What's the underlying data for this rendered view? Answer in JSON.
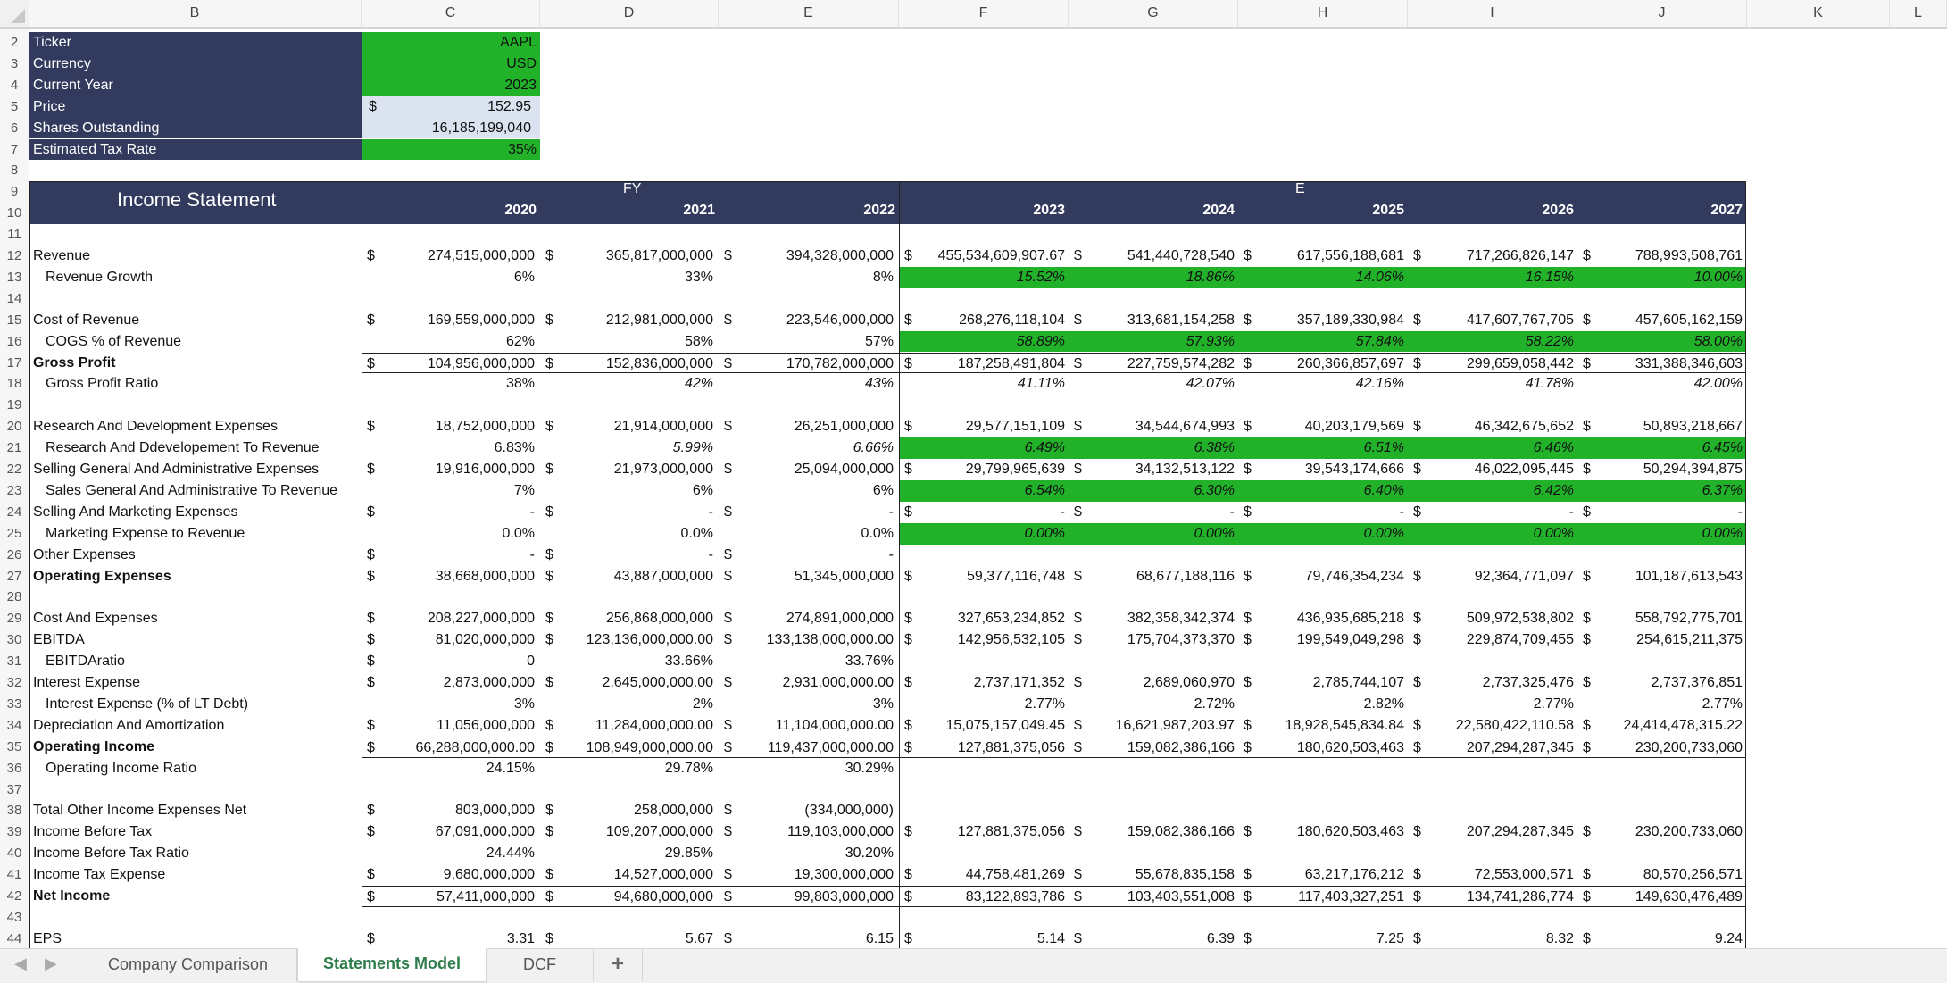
{
  "columns": [
    "B",
    "C",
    "D",
    "E",
    "F",
    "G",
    "H",
    "I",
    "J",
    "K",
    "L"
  ],
  "row_numbers": [
    "2",
    "3",
    "4",
    "5",
    "6",
    "7",
    "8",
    "9",
    "10",
    "11",
    "12",
    "13",
    "14",
    "15",
    "16",
    "17",
    "18",
    "19",
    "20",
    "21",
    "22",
    "23",
    "24",
    "25",
    "26",
    "27",
    "28",
    "29",
    "30",
    "31",
    "32",
    "33",
    "34",
    "35",
    "36",
    "37",
    "38",
    "39",
    "40",
    "41",
    "42",
    "43",
    "44"
  ],
  "info": {
    "ticker_label": "Ticker",
    "ticker": "AAPL",
    "currency_label": "Currency",
    "currency": "USD",
    "year_label": "Current Year",
    "year": "2023",
    "price_label": "Price",
    "price_symbol": "$",
    "price": "152.95",
    "shares_label": "Shares Outstanding",
    "shares": "16,185,199,040",
    "tax_label": "Estimated Tax Rate",
    "tax": "35%"
  },
  "statement": {
    "title": "Income Statement",
    "fy_label": "FY",
    "e_label": "E",
    "years": [
      "2020",
      "2021",
      "2022",
      "2023",
      "2024",
      "2025",
      "2026",
      "2027"
    ],
    "rows": [
      {
        "n": "12",
        "label": "Revenue",
        "style": "plain",
        "dollar": [
          1,
          1,
          1,
          1,
          1,
          1,
          1,
          1
        ],
        "values": [
          "274,515,000,000",
          "365,817,000,000",
          "394,328,000,000",
          "455,534,609,907.67",
          "541,440,728,540",
          "617,556,188,681",
          "717,266,826,147",
          "788,993,508,761"
        ]
      },
      {
        "n": "13",
        "label": "Revenue Growth",
        "style": "ind",
        "green": true,
        "values": [
          "6%",
          "33%",
          "8%",
          "15.52%",
          "18.86%",
          "14.06%",
          "16.15%",
          "10.00%"
        ]
      },
      {
        "n": "15",
        "label": "Cost of Revenue",
        "style": "plain",
        "dollar": [
          1,
          1,
          1,
          1,
          1,
          1,
          1,
          1
        ],
        "values": [
          "169,559,000,000",
          "212,981,000,000",
          "223,546,000,000",
          "268,276,118,104",
          "313,681,154,258",
          "357,189,330,984",
          "417,607,767,705",
          "457,605,162,159"
        ]
      },
      {
        "n": "16",
        "label": "COGS % of Revenue",
        "style": "ind",
        "green": true,
        "values": [
          "62%",
          "58%",
          "57%",
          "58.89%",
          "57.93%",
          "57.84%",
          "58.22%",
          "58.00%"
        ]
      },
      {
        "n": "17",
        "label": "Gross Profit",
        "style": "bold",
        "lines": "box",
        "dollar": [
          1,
          1,
          1,
          1,
          1,
          1,
          1,
          1
        ],
        "values": [
          "104,956,000,000",
          "152,836,000,000",
          "170,782,000,000",
          "187,258,491,804",
          "227,759,574,282",
          "260,366,857,697",
          "299,659,058,442",
          "331,388,346,603"
        ]
      },
      {
        "n": "18",
        "label": "Gross Profit Ratio",
        "style": "ind",
        "italic_from": 1,
        "values": [
          "38%",
          "42%",
          "43%",
          "41.11%",
          "42.07%",
          "42.16%",
          "41.78%",
          "42.00%"
        ]
      },
      {
        "n": "20",
        "label": "Research And Development Expenses",
        "style": "plain",
        "dollar": [
          1,
          1,
          1,
          1,
          1,
          1,
          1,
          1
        ],
        "values": [
          "18,752,000,000",
          "21,914,000,000",
          "26,251,000,000",
          "29,577,151,109",
          "34,544,674,993",
          "40,203,179,569",
          "46,342,675,652",
          "50,893,218,667"
        ]
      },
      {
        "n": "21",
        "label": "Research And Ddevelopement To Revenue",
        "style": "ind",
        "green": true,
        "italic_from": 1,
        "values": [
          "6.83%",
          "5.99%",
          "6.66%",
          "6.49%",
          "6.38%",
          "6.51%",
          "6.46%",
          "6.45%"
        ]
      },
      {
        "n": "22",
        "label": "Selling General And Administrative Expenses",
        "style": "plain",
        "dollar": [
          1,
          1,
          1,
          1,
          1,
          1,
          1,
          1
        ],
        "values": [
          "19,916,000,000",
          "21,973,000,000",
          "25,094,000,000",
          "29,799,965,639",
          "34,132,513,122",
          "39,543,174,666",
          "46,022,095,445",
          "50,294,394,875"
        ]
      },
      {
        "n": "23",
        "label": "Sales General And Administrative To Revenue",
        "style": "ind",
        "green": true,
        "values": [
          "7%",
          "6%",
          "6%",
          "6.54%",
          "6.30%",
          "6.40%",
          "6.42%",
          "6.37%"
        ]
      },
      {
        "n": "24",
        "label": "Selling And Marketing Expenses",
        "style": "plain",
        "dollar": [
          1,
          1,
          1,
          1,
          1,
          1,
          1,
          1
        ],
        "values": [
          "-",
          "-",
          "-",
          "-",
          "-",
          "-",
          "-",
          "-"
        ]
      },
      {
        "n": "25",
        "label": "Marketing Expense to Revenue",
        "style": "ind",
        "green": true,
        "values": [
          "0.0%",
          "0.0%",
          "0.0%",
          "0.00%",
          "0.00%",
          "0.00%",
          "0.00%",
          "0.00%"
        ]
      },
      {
        "n": "26",
        "label": "Other Expenses",
        "style": "plain",
        "dollar": [
          1,
          1,
          1,
          0,
          0,
          0,
          0,
          0
        ],
        "values": [
          "-",
          "-",
          "-",
          "",
          "",
          "",
          "",
          ""
        ]
      },
      {
        "n": "27",
        "label": "Operating Expenses",
        "style": "bold",
        "dollar": [
          1,
          1,
          1,
          1,
          1,
          1,
          1,
          1
        ],
        "values": [
          "38,668,000,000",
          "43,887,000,000",
          "51,345,000,000",
          "59,377,116,748",
          "68,677,188,116",
          "79,746,354,234",
          "92,364,771,097",
          "101,187,613,543"
        ]
      },
      {
        "n": "29",
        "label": "Cost And Expenses",
        "style": "plain",
        "dollar": [
          1,
          1,
          1,
          1,
          1,
          1,
          1,
          1
        ],
        "values": [
          "208,227,000,000",
          "256,868,000,000",
          "274,891,000,000",
          "327,653,234,852",
          "382,358,342,374",
          "436,935,685,218",
          "509,972,538,802",
          "558,792,775,701"
        ]
      },
      {
        "n": "30",
        "label": "EBITDA",
        "style": "plain",
        "dollar": [
          1,
          1,
          1,
          1,
          1,
          1,
          1,
          1
        ],
        "values": [
          "81,020,000,000",
          "123,136,000,000.00",
          "133,138,000,000.00",
          "142,956,532,105",
          "175,704,373,370",
          "199,549,049,298",
          "229,874,709,455",
          "254,615,211,375"
        ]
      },
      {
        "n": "31",
        "label": "EBITDAratio",
        "style": "ind",
        "dollar": [
          1,
          0,
          0,
          0,
          0,
          0,
          0,
          0
        ],
        "values": [
          "0",
          "33.66%",
          "33.76%",
          "",
          "",
          "",
          "",
          ""
        ]
      },
      {
        "n": "32",
        "label": "Interest Expense",
        "style": "plain",
        "dollar": [
          1,
          1,
          1,
          1,
          1,
          1,
          1,
          1
        ],
        "values": [
          "2,873,000,000",
          "2,645,000,000.00",
          "2,931,000,000.00",
          "2,737,171,352",
          "2,689,060,970",
          "2,785,744,107",
          "2,737,325,476",
          "2,737,376,851"
        ]
      },
      {
        "n": "33",
        "label": "Interest Expense (% of LT Debt)",
        "style": "ind",
        "values": [
          "3%",
          "2%",
          "3%",
          "2.77%",
          "2.72%",
          "2.82%",
          "2.77%",
          "2.77%"
        ]
      },
      {
        "n": "34",
        "label": "Depreciation And Amortization",
        "style": "plain",
        "dollar": [
          1,
          1,
          1,
          1,
          1,
          1,
          1,
          1
        ],
        "values": [
          "11,056,000,000",
          "11,284,000,000.00",
          "11,104,000,000.00",
          "15,075,157,049.45",
          "16,621,987,203.97",
          "18,928,545,834.84",
          "22,580,422,110.58",
          "24,414,478,315.22"
        ]
      },
      {
        "n": "35",
        "label": "Operating Income",
        "style": "bold",
        "lines": "box",
        "dollar": [
          1,
          1,
          1,
          1,
          1,
          1,
          1,
          1
        ],
        "values": [
          "66,288,000,000.00",
          "108,949,000,000.00",
          "119,437,000,000.00",
          "127,881,375,056",
          "159,082,386,166",
          "180,620,503,463",
          "207,294,287,345",
          "230,200,733,060"
        ]
      },
      {
        "n": "36",
        "label": "Operating Income Ratio",
        "style": "ind",
        "values": [
          "24.15%",
          "29.78%",
          "30.29%",
          "",
          "",
          "",
          "",
          ""
        ]
      },
      {
        "n": "38",
        "label": "Total Other Income Expenses Net",
        "style": "plain",
        "dollar": [
          1,
          1,
          1,
          0,
          0,
          0,
          0,
          0
        ],
        "values": [
          "803,000,000",
          "258,000,000",
          "(334,000,000)",
          "",
          "",
          "",
          "",
          ""
        ]
      },
      {
        "n": "39",
        "label": "Income Before Tax",
        "style": "plain",
        "dollar": [
          1,
          1,
          1,
          1,
          1,
          1,
          1,
          1
        ],
        "values": [
          "67,091,000,000",
          "109,207,000,000",
          "119,103,000,000",
          "127,881,375,056",
          "159,082,386,166",
          "180,620,503,463",
          "207,294,287,345",
          "230,200,733,060"
        ]
      },
      {
        "n": "40",
        "label": "Income Before Tax Ratio",
        "style": "plain",
        "values": [
          "24.44%",
          "29.85%",
          "30.20%",
          "",
          "",
          "",
          "",
          ""
        ]
      },
      {
        "n": "41",
        "label": "Income Tax Expense",
        "style": "plain",
        "dollar": [
          1,
          1,
          1,
          1,
          1,
          1,
          1,
          1
        ],
        "values": [
          "9,680,000,000",
          "14,527,000,000",
          "19,300,000,000",
          "44,758,481,269",
          "55,678,835,158",
          "63,217,176,212",
          "72,553,000,571",
          "80,570,256,571"
        ]
      },
      {
        "n": "42",
        "label": "Net Income",
        "style": "bold",
        "lines": "double",
        "dollar": [
          1,
          1,
          1,
          1,
          1,
          1,
          1,
          1
        ],
        "values": [
          "57,411,000,000",
          "94,680,000,000",
          "99,803,000,000",
          "83,122,893,786",
          "103,403,551,008",
          "117,403,327,251",
          "134,741,286,774",
          "149,630,476,489"
        ]
      },
      {
        "n": "44",
        "label": "EPS",
        "style": "plain",
        "dollar": [
          1,
          1,
          1,
          1,
          1,
          1,
          1,
          1
        ],
        "values": [
          "3.31",
          "5.67",
          "6.15",
          "5.14",
          "6.39",
          "7.25",
          "8.32",
          "9.24"
        ]
      }
    ]
  },
  "sheet_tabs": {
    "prev_icon": "◀",
    "next_icon": "▶",
    "tabs": [
      "Company Comparison",
      "Statements Model",
      "DCF"
    ],
    "active": "Statements Model",
    "add_label": "+"
  },
  "colors": {
    "navy": "#323b5e",
    "green": "#22b22a",
    "active_tab": "#2e7d4a"
  }
}
